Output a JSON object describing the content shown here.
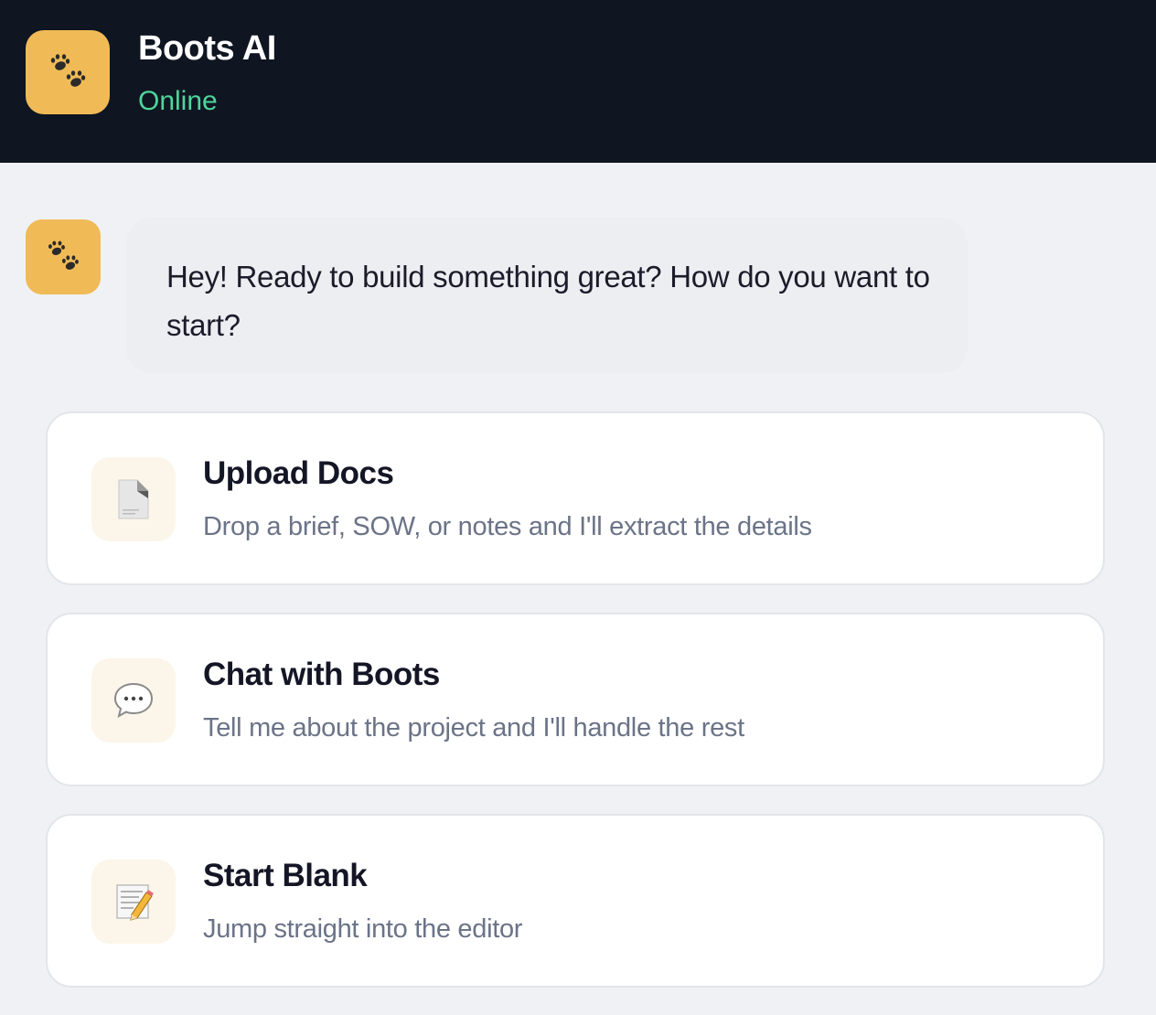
{
  "header": {
    "title": "Boots AI",
    "status": "Online",
    "avatar_icon": "paw-prints-icon"
  },
  "message": {
    "avatar_icon": "paw-prints-icon",
    "text": "Hey! Ready to build something great? How do you want to start?"
  },
  "options": [
    {
      "icon": "document-icon",
      "title": "Upload Docs",
      "description": "Drop a brief, SOW, or notes and I'll extract the details"
    },
    {
      "icon": "speech-bubble-icon",
      "title": "Chat with Boots",
      "description": "Tell me about the project and I'll handle the rest"
    },
    {
      "icon": "memo-pencil-icon",
      "title": "Start Blank",
      "description": "Jump straight into the editor"
    }
  ],
  "colors": {
    "header_bg": "#0f1521",
    "accent": "#f0bb57",
    "online": "#4ed59a",
    "background": "#f0f1f4"
  }
}
